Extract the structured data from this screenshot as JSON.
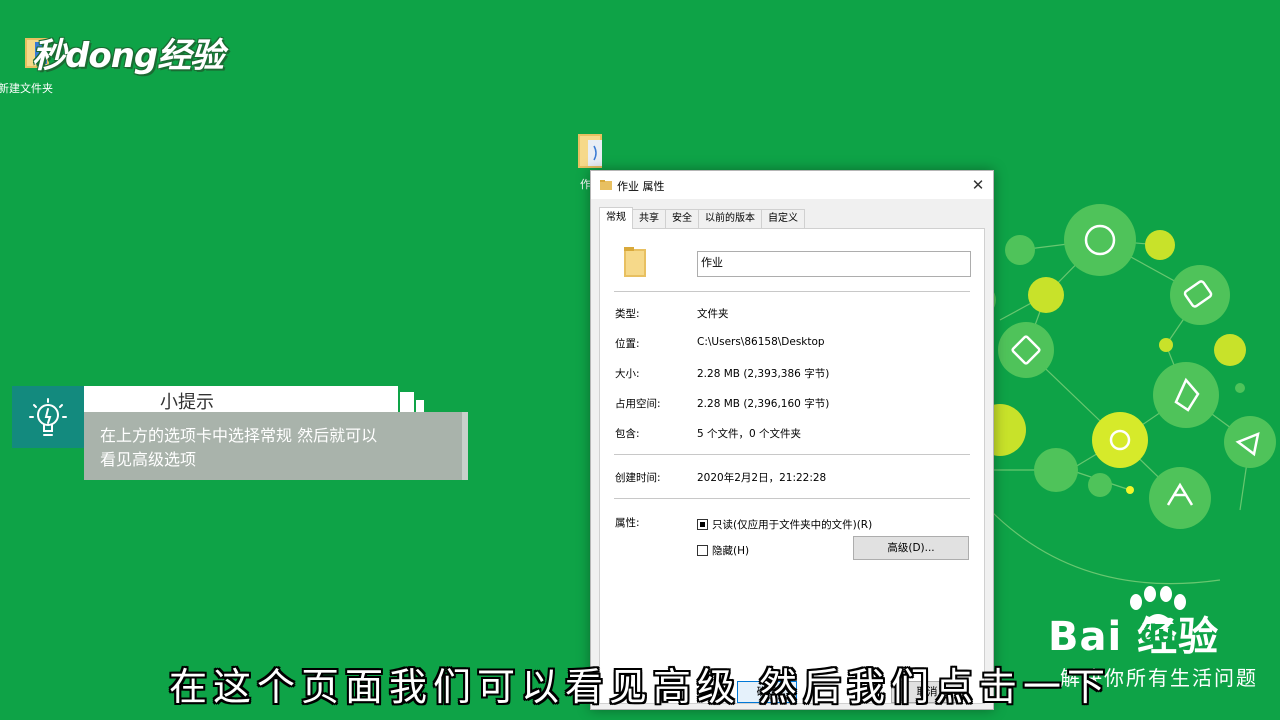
{
  "desktop": {
    "brand_logo": "秒dong经验",
    "folder_label": "新建文件夹",
    "folder2_label": "作"
  },
  "tip": {
    "title": "小提示",
    "line1": "在上方的选项卡中选择常规 然后就可以",
    "line2": "看见高级选项"
  },
  "dialog": {
    "title": "作业 属性",
    "close": "✕",
    "tabs": [
      "常规",
      "共享",
      "安全",
      "以前的版本",
      "自定义"
    ],
    "name_value": "作业",
    "props": {
      "type_label": "类型:",
      "type_value": "文件夹",
      "location_label": "位置:",
      "location_value": "C:\\Users\\86158\\Desktop",
      "size_label": "大小:",
      "size_value": "2.28 MB (2,393,386 字节)",
      "disk_label": "占用空间:",
      "disk_value": "2.28 MB (2,396,160 字节)",
      "contains_label": "包含:",
      "contains_value": "5 个文件，0 个文件夹",
      "created_label": "创建时间:",
      "created_value": "2020年2月2日，21:22:28",
      "attr_label": "属性:"
    },
    "readonly_label": "只读(仅应用于文件夹中的文件)(R)",
    "readonly_checked": true,
    "hidden_label": "隐藏(H)",
    "hidden_checked": false,
    "advanced_button": "高级(D)...",
    "ok_button": "确定",
    "cancel_button": "取消"
  },
  "watermark": {
    "baidu": "Bai  经验",
    "du": "du",
    "slogan": "解决你所有生活问题"
  },
  "subtitle": "在这个页面我们可以看见高级 然后我们点击一下",
  "colors": {
    "background": "#0ea347",
    "tip_teal": "#138a7e",
    "tip_body": "#a9b3ab"
  }
}
